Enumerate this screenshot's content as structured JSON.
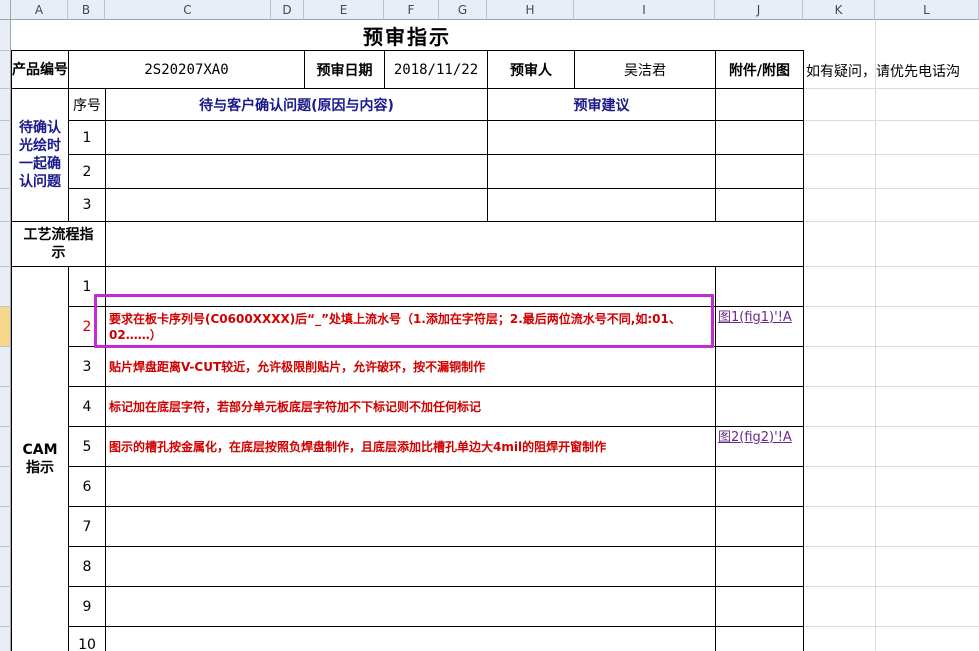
{
  "columns": [
    "A",
    "B",
    "C",
    "D",
    "E",
    "F",
    "G",
    "H",
    "I",
    "J",
    "K",
    "L"
  ],
  "rows_visible_markers": [
    "6"
  ],
  "sheet": {
    "title": "预审指示",
    "product_no_label": "产品编号",
    "product_no": "2S20207XA0",
    "review_date_label": "预审日期",
    "review_date": "2018/11/22",
    "reviewer_label": "预审人",
    "reviewer": "吴洁君",
    "attachment_label": "附件/附图",
    "note": "如有疑问，请优先电话沟",
    "confirm_section_label": "待确认光绘时一起确认问题",
    "seq_label": "序号",
    "issue_header": "待与客户确认问题(原因与内容)",
    "suggest_header": "预审建议",
    "confirm_rows": [
      "1",
      "2",
      "3"
    ],
    "process_label": "工艺流程指示",
    "cam_label": "CAM指示",
    "cam_rows": [
      {
        "no": "1",
        "text": "",
        "link": ""
      },
      {
        "no": "2",
        "text": "要求在板卡序列号(C0600XXXX)后“_”处填上流水号（1.添加在字符层；2.最后两位流水号不同,如:01、02……）",
        "link": "图1(fig1)'!A"
      },
      {
        "no": "3",
        "text": "贴片焊盘距离V-CUT较近，允许极限削贴片，允许破环，按不漏铜制作",
        "link": ""
      },
      {
        "no": "4",
        "text": "标记加在底层字符，若部分单元板底层字符加不下标记则不加任何标记",
        "link": ""
      },
      {
        "no": "5",
        "text": "图示的槽孔按金属化，在底层按照负焊盘制作，且底层添加比槽孔单边大4mil的阻焊开窗制作",
        "link": "图2(fig2)'!A"
      },
      {
        "no": "6",
        "text": "",
        "link": ""
      },
      {
        "no": "7",
        "text": "",
        "link": ""
      },
      {
        "no": "8",
        "text": "",
        "link": ""
      },
      {
        "no": "9",
        "text": "",
        "link": ""
      },
      {
        "no": "10",
        "text": "",
        "link": ""
      }
    ]
  },
  "colors": {
    "highlight": "#c02bd6",
    "red_text": "#d00000",
    "blue_text": "#1a1a8c",
    "link": "#6a2a8c"
  }
}
